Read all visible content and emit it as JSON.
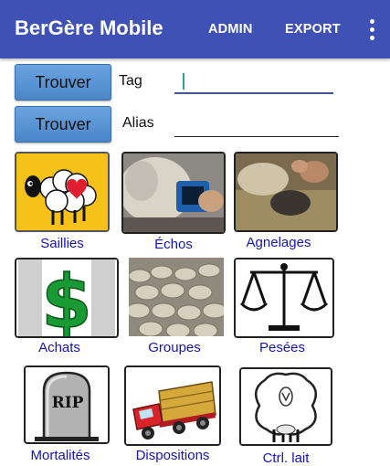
{
  "appbar": {
    "title": "BerGère Mobile",
    "admin": "ADMIN",
    "export": "EXPORT"
  },
  "search": [
    {
      "button": "Trouver",
      "label": "Tag",
      "value": ""
    },
    {
      "button": "Trouver",
      "label": "Alias",
      "value": ""
    }
  ],
  "tiles": [
    {
      "label": "Saillies",
      "icon": "sheep-heart-icon"
    },
    {
      "label": "Échos",
      "icon": "ultrasound-photo"
    },
    {
      "label": "Agnelages",
      "icon": "lambing-photo"
    },
    {
      "label": "Achats",
      "icon": "dollar-icon"
    },
    {
      "label": "Groupes",
      "icon": "sheep-flock-photo"
    },
    {
      "label": "Pesées",
      "icon": "scale-icon"
    },
    {
      "label": "Mortalités",
      "icon": "tombstone-icon"
    },
    {
      "label": "Dispositions",
      "icon": "truck-icon"
    },
    {
      "label": "Ctrl. lait",
      "icon": "milk-sheep-icon"
    }
  ],
  "colors": {
    "appbar": "#3f51b5",
    "button": "#4f8fd3",
    "tile_label": "#1515b5"
  }
}
